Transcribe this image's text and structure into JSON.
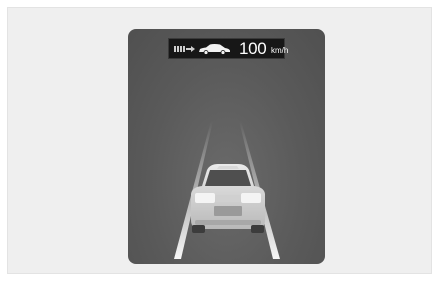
{
  "cluster": {
    "speed": {
      "value": "100",
      "unit": "km/h"
    },
    "icons": {
      "distance": "following-distance-icon",
      "vehicle": "lead-vehicle-icon"
    }
  },
  "colors": {
    "background": "#efefef",
    "cluster": "#5a5a5a",
    "display_bar": "#171717",
    "text": "#ffffff"
  }
}
